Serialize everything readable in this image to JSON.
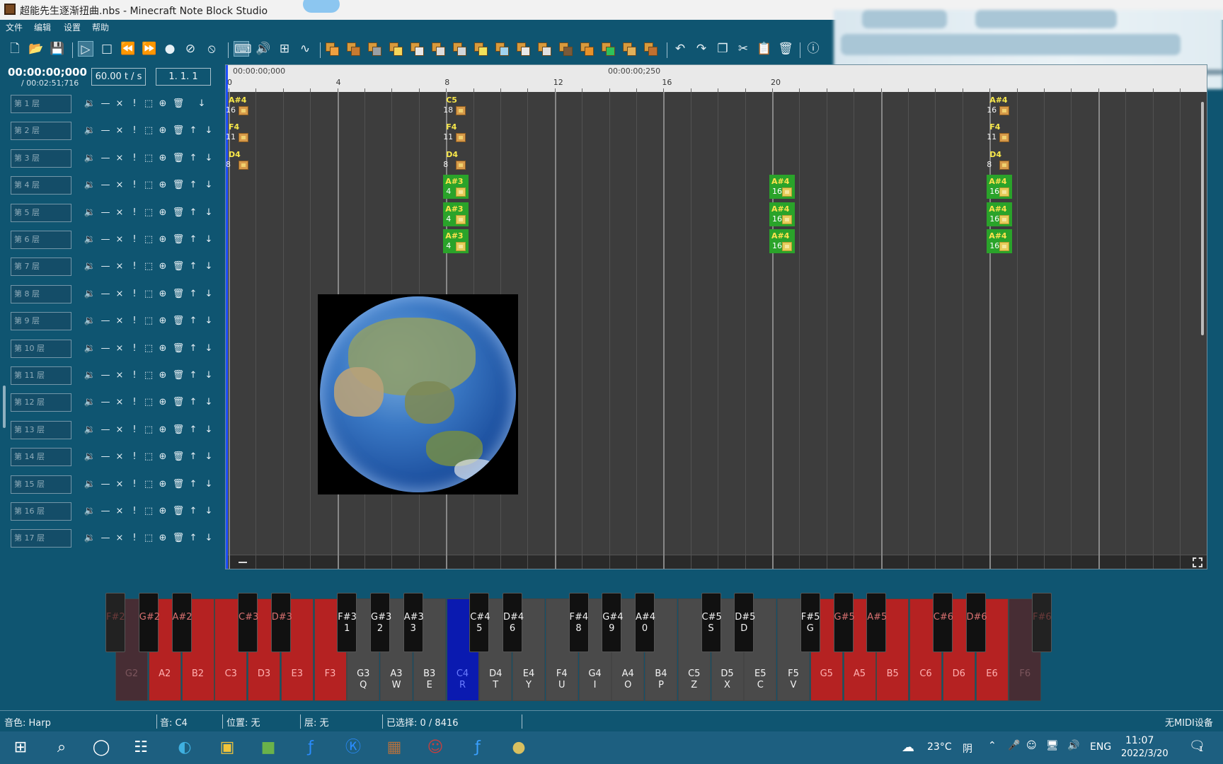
{
  "window": {
    "title": "超能先生逐渐扭曲.nbs - Minecraft Note Block Studio"
  },
  "menu": [
    "文件",
    "编辑",
    "设置",
    "帮助"
  ],
  "time": {
    "current": "00:00:00;000",
    "total": "/ 00:02:51;716"
  },
  "tempo": "60.00 t / s",
  "position": "1. 1. 1",
  "ruler": {
    "time_start": "00:00:00;000",
    "time_mid": "00:00:00;250",
    "numbers": [
      "0",
      "4",
      "8",
      "12",
      "16",
      "20"
    ]
  },
  "layers": [
    "第 1 层",
    "第 2 层",
    "第 3 层",
    "第 4 层",
    "第 5 层",
    "第 6 层",
    "第 7 层",
    "第 8 层",
    "第 9 层",
    "第 10 层",
    "第 11 层",
    "第 12 层",
    "第 13 层",
    "第 14 层",
    "第 15 层",
    "第 16 层",
    "第 17 层"
  ],
  "notes": [
    {
      "key": "A#4",
      "val": "16",
      "tick": 0,
      "layer": 0,
      "kind": "orange"
    },
    {
      "key": "F4",
      "val": "11",
      "tick": 0,
      "layer": 1,
      "kind": "orange"
    },
    {
      "key": "D4",
      "val": "8",
      "tick": 0,
      "layer": 2,
      "kind": "orange"
    },
    {
      "key": "C5",
      "val": "18",
      "tick": 8,
      "layer": 0,
      "kind": "orange"
    },
    {
      "key": "F4",
      "val": "11",
      "tick": 8,
      "layer": 1,
      "kind": "orange"
    },
    {
      "key": "D4",
      "val": "8",
      "tick": 8,
      "layer": 2,
      "kind": "orange"
    },
    {
      "key": "A#3",
      "val": "4",
      "tick": 8,
      "layer": 3,
      "kind": "green"
    },
    {
      "key": "A#3",
      "val": "4",
      "tick": 8,
      "layer": 4,
      "kind": "green"
    },
    {
      "key": "A#3",
      "val": "4",
      "tick": 8,
      "layer": 5,
      "kind": "green"
    },
    {
      "key": "A#4",
      "val": "16",
      "tick": 20,
      "layer": 3,
      "kind": "green"
    },
    {
      "key": "A#4",
      "val": "16",
      "tick": 20,
      "layer": 4,
      "kind": "green"
    },
    {
      "key": "A#4",
      "val": "16",
      "tick": 20,
      "layer": 5,
      "kind": "green"
    },
    {
      "key": "A#4",
      "val": "16",
      "tick": 28,
      "layer": 0,
      "kind": "orange"
    },
    {
      "key": "F4",
      "val": "11",
      "tick": 28,
      "layer": 1,
      "kind": "orange"
    },
    {
      "key": "D4",
      "val": "8",
      "tick": 28,
      "layer": 2,
      "kind": "orange"
    },
    {
      "key": "A#4",
      "val": "16",
      "tick": 28,
      "layer": 3,
      "kind": "green"
    },
    {
      "key": "A#4",
      "val": "16",
      "tick": 28,
      "layer": 4,
      "kind": "green"
    },
    {
      "key": "A#4",
      "val": "16",
      "tick": 28,
      "layer": 5,
      "kind": "green"
    }
  ],
  "piano": {
    "white": [
      {
        "note": "G2",
        "key": "",
        "state": "fade"
      },
      {
        "note": "A2",
        "key": "",
        "state": "red"
      },
      {
        "note": "B2",
        "key": "",
        "state": "red"
      },
      {
        "note": "C3",
        "key": "",
        "state": "red"
      },
      {
        "note": "D3",
        "key": "",
        "state": "red"
      },
      {
        "note": "E3",
        "key": "",
        "state": "red"
      },
      {
        "note": "F3",
        "key": "",
        "state": "red"
      },
      {
        "note": "G3",
        "key": "Q",
        "state": "norm"
      },
      {
        "note": "A3",
        "key": "W",
        "state": "norm"
      },
      {
        "note": "B3",
        "key": "E",
        "state": "norm"
      },
      {
        "note": "C4",
        "key": "R",
        "state": "sel"
      },
      {
        "note": "D4",
        "key": "T",
        "state": "norm"
      },
      {
        "note": "E4",
        "key": "Y",
        "state": "norm"
      },
      {
        "note": "F4",
        "key": "U",
        "state": "norm"
      },
      {
        "note": "G4",
        "key": "I",
        "state": "norm"
      },
      {
        "note": "A4",
        "key": "O",
        "state": "norm"
      },
      {
        "note": "B4",
        "key": "P",
        "state": "norm"
      },
      {
        "note": "C5",
        "key": "Z",
        "state": "norm"
      },
      {
        "note": "D5",
        "key": "X",
        "state": "norm"
      },
      {
        "note": "E5",
        "key": "C",
        "state": "norm"
      },
      {
        "note": "F5",
        "key": "V",
        "state": "norm"
      },
      {
        "note": "G5",
        "key": "",
        "state": "red"
      },
      {
        "note": "A5",
        "key": "",
        "state": "red"
      },
      {
        "note": "B5",
        "key": "",
        "state": "red"
      },
      {
        "note": "C6",
        "key": "",
        "state": "red"
      },
      {
        "note": "D6",
        "key": "",
        "state": "red"
      },
      {
        "note": "E6",
        "key": "",
        "state": "red"
      },
      {
        "note": "F6",
        "key": "",
        "state": "fade"
      }
    ],
    "black": [
      {
        "note": "F#2",
        "key": "",
        "state": "fade"
      },
      {
        "note": "G#2",
        "key": "",
        "state": "red"
      },
      {
        "note": "A#2",
        "key": "",
        "state": "red"
      },
      {
        "note": "C#3",
        "key": "",
        "state": "red"
      },
      {
        "note": "D#3",
        "key": "",
        "state": "red"
      },
      {
        "note": "F#3",
        "key": "1",
        "state": "norm"
      },
      {
        "note": "G#3",
        "key": "2",
        "state": "norm"
      },
      {
        "note": "A#3",
        "key": "3",
        "state": "norm"
      },
      {
        "note": "C#4",
        "key": "5",
        "state": "norm"
      },
      {
        "note": "D#4",
        "key": "6",
        "state": "norm"
      },
      {
        "note": "F#4",
        "key": "8",
        "state": "norm"
      },
      {
        "note": "G#4",
        "key": "9",
        "state": "norm"
      },
      {
        "note": "A#4",
        "key": "0",
        "state": "norm"
      },
      {
        "note": "C#5",
        "key": "S",
        "state": "norm"
      },
      {
        "note": "D#5",
        "key": "D",
        "state": "norm"
      },
      {
        "note": "F#5",
        "key": "G",
        "state": "norm"
      },
      {
        "note": "G#5",
        "key": "",
        "state": "red"
      },
      {
        "note": "A#5",
        "key": "",
        "state": "red"
      },
      {
        "note": "C#6",
        "key": "",
        "state": "red"
      },
      {
        "note": "D#6",
        "key": "",
        "state": "red"
      },
      {
        "note": "F#6",
        "key": "",
        "state": "fade"
      }
    ]
  },
  "status": {
    "instrument": "音色: Harp",
    "pitch": "音: C4",
    "position": "位置: 无",
    "layer": "层: 无",
    "selected": "已选择: 0 / 8416",
    "midi": "无MIDI设备"
  },
  "taskbar": {
    "temp": "23°C",
    "weather": "阴",
    "lang": "ENG",
    "time": "11:07",
    "date": "2022/3/20",
    "notif": "1"
  }
}
